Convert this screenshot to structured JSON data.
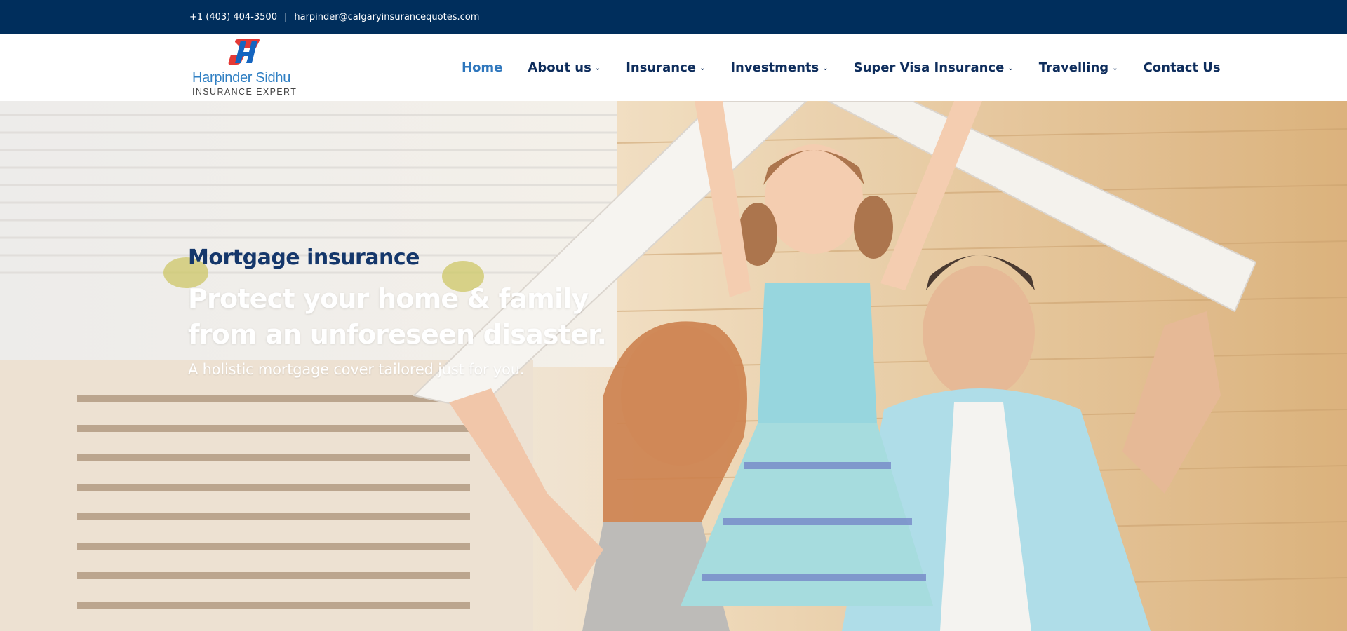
{
  "topbar": {
    "phone": "+1 (403) 404-3500",
    "separator": "|",
    "email": "harpinder@calgaryinsurancequotes.com"
  },
  "logo": {
    "name": "Harpinder Sidhu",
    "tagline": "INSURANCE EXPERT",
    "colors": {
      "red": "#e53935",
      "blue": "#1565c0"
    }
  },
  "nav": {
    "items": [
      {
        "label": "Home",
        "active": true
      },
      {
        "label": "About us",
        "dropdown": true
      },
      {
        "label": "Insurance",
        "dropdown": true
      },
      {
        "label": "Investments",
        "dropdown": true
      },
      {
        "label": "Super Visa Insurance",
        "dropdown": true
      },
      {
        "label": "Travelling",
        "dropdown": true
      },
      {
        "label": "Contact Us"
      }
    ],
    "chevron_icon": "chevron-down-icon"
  },
  "hero": {
    "kicker": "Mortgage insurance",
    "headline_line1": "Protect your home & family",
    "headline_line2": "from an unforeseen disaster.",
    "subline": "A holistic mortgage cover tailored just for you.",
    "image": "family-under-roof-photo"
  },
  "colors": {
    "topbar_bg": "#002e5c",
    "nav_text": "#0e2d5c",
    "nav_active": "#2f77bd",
    "kicker": "#15376b"
  }
}
